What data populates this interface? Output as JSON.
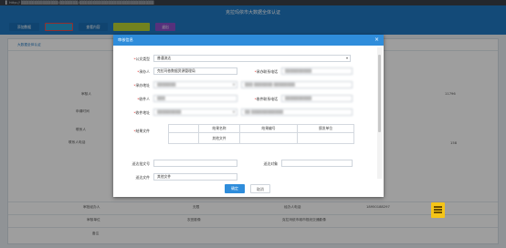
{
  "browser": {
    "url": "▌ http:// ▒▒▒▒▒▒▒▒▒▒▒▒▒▒/▒▒▒▒▒▒▒/▒▒▒▒▒▒▒▒▒▒▒▒▒▒▒▒▒▒▒▒▒▒▒▒▒▒▒▒"
  },
  "app": {
    "title": "克拉玛依市大数据全体认证"
  },
  "toolbar": {
    "buttons": [
      {
        "label": "添加数据",
        "color": "#1b6fb5"
      },
      {
        "label": "",
        "color": "#26a0d6",
        "border": "#e84c4c"
      },
      {
        "label": "查看内容",
        "color": "#1b6fb5"
      },
      {
        "label": "",
        "color": "#b8d232"
      },
      {
        "label": "退出",
        "color": "#8b4fc9"
      }
    ]
  },
  "background": {
    "section_title": "大数据全体认证",
    "rows": [
      {
        "label": "审核人",
        "value": ""
      },
      {
        "label": "申请时间",
        "value": ""
      },
      {
        "label": "联系人",
        "value": ""
      },
      {
        "label": "联系人电话",
        "value": ""
      }
    ],
    "bottom_rows": [
      [
        "审批经办人",
        "无限",
        "经办人电话",
        "18950188297"
      ],
      [
        "审核单位",
        "农田影像",
        "克拉玛依市城市规划交通影像",
        ""
      ],
      [
        "备注",
        "",
        "",
        ""
      ]
    ],
    "right_values": [
      "11796",
      "158"
    ]
  },
  "dialog": {
    "title": "审核信息",
    "close": "×",
    "fields": {
      "doc_type": {
        "label": "公文类型",
        "value": "普通流达",
        "required": true
      },
      "handler": {
        "label": "承办人",
        "value": "克拉玛依数据资源管理局",
        "required": true
      },
      "handler_phone": {
        "label": "承办联系电话",
        "value": "▒▒▒▒▒▒▒▒▒▒",
        "required": true
      },
      "handler_addr": {
        "label": "承办地址",
        "value": "▒▒▒▒▒▒▒",
        "required": true
      },
      "handler_addr2": {
        "value": "▒▒▒ ▒▒▒▒▒▒▒ ▒▒▒▒▒▒▒▒"
      },
      "receiver": {
        "label": "收件人",
        "value": "▒▒▒",
        "required": true
      },
      "receiver_phone": {
        "label": "收件联系电话",
        "value": "▒▒▒▒▒▒▒▒▒▒",
        "required": true
      },
      "receiver_addr": {
        "label": "收件地址",
        "value": "▒▒▒▒▒▒▒▒▒",
        "required": true
      },
      "receiver_addr2": {
        "value": "▒▒ ▒▒▒▒▒▒▒▒▒▒▒▒"
      },
      "result_doc": {
        "label": "结果文件"
      },
      "send_no": {
        "label": "送达批文号",
        "value": ""
      },
      "send_target": {
        "label": "送达对象",
        "value": ""
      },
      "send_file": {
        "label": "送达文件",
        "value": "其他文件"
      }
    },
    "table": {
      "headers": [
        "结果名称",
        "结果编号",
        "颁发单位"
      ],
      "rows": [
        [
          "其他文件",
          "",
          ""
        ]
      ]
    },
    "buttons": {
      "ok": "确定",
      "cancel": "取消"
    }
  }
}
